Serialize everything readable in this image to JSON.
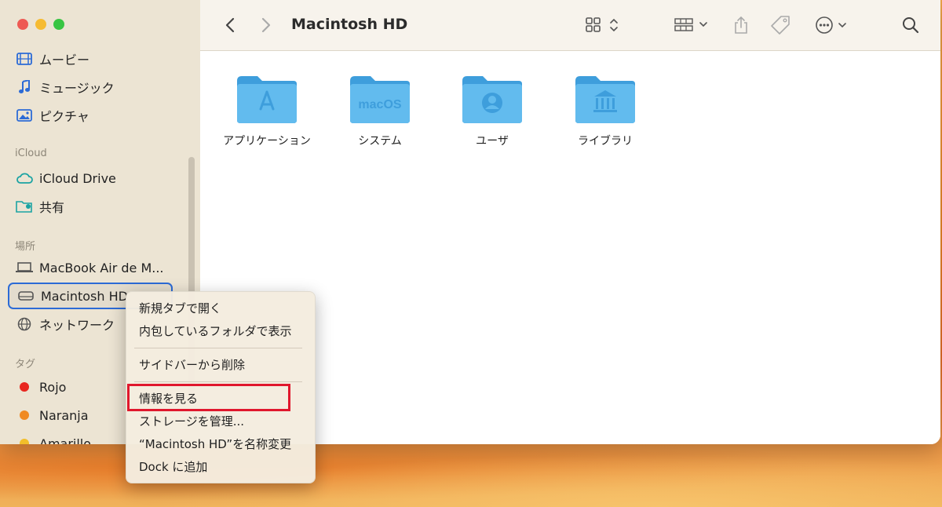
{
  "window": {
    "title": "Macintosh HD"
  },
  "sidebar": {
    "items_top": [
      {
        "label": "ムービー",
        "icon": "film-icon"
      },
      {
        "label": "ミュージック",
        "icon": "music-note-icon"
      },
      {
        "label": "ピクチャ",
        "icon": "photo-icon"
      }
    ],
    "icloud_header": "iCloud",
    "icloud_items": [
      {
        "label": "iCloud Drive",
        "icon": "cloud-icon"
      },
      {
        "label": "共有",
        "icon": "shared-folder-icon"
      }
    ],
    "locations_header": "場所",
    "location_items": [
      {
        "label": "MacBook Air de M...",
        "icon": "laptop-icon"
      },
      {
        "label": "Macintosh HD",
        "icon": "disk-icon"
      },
      {
        "label": "ネットワーク",
        "icon": "globe-icon"
      }
    ],
    "tags_header": "タグ",
    "tags": [
      {
        "label": "Rojo",
        "color": "#e8261f"
      },
      {
        "label": "Naranja",
        "color": "#f08a22"
      },
      {
        "label": "Amarillo",
        "color": "#f2be2a"
      }
    ]
  },
  "folders": [
    {
      "label": "アプリケーション",
      "icon": "app-store-glyph"
    },
    {
      "label": "システム",
      "icon": "macos-glyph",
      "glyph_text": "macOS"
    },
    {
      "label": "ユーザ",
      "icon": "user-glyph"
    },
    {
      "label": "ライブラリ",
      "icon": "library-glyph"
    }
  ],
  "context_menu": {
    "items": [
      "新規タブで開く",
      "内包しているフォルダで表示",
      "サイドバーから削除",
      "情報を見る",
      "ストレージを管理...",
      "“Macintosh HD”を名称変更",
      "Dock に追加"
    ],
    "highlighted": "情報を見る"
  },
  "colors": {
    "accent": "#2c6bd6",
    "folder": "#5cb6ec",
    "highlight": "#e0172d"
  }
}
